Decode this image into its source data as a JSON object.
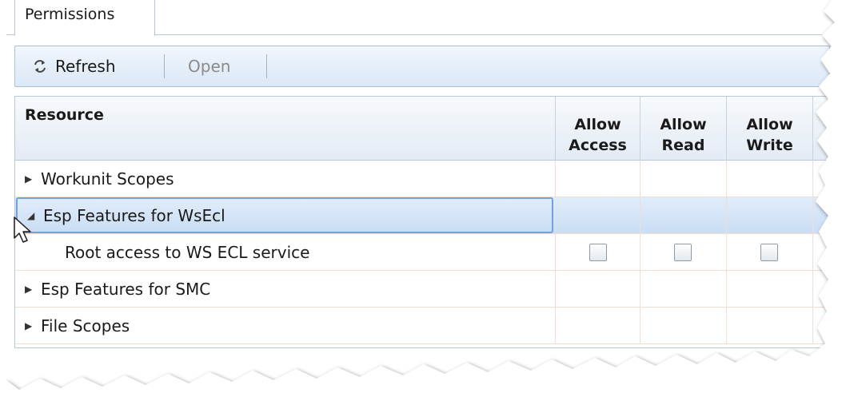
{
  "tab": {
    "label": "Permissions"
  },
  "toolbar": {
    "refresh_label": "Refresh",
    "open_label": "Open"
  },
  "columns": {
    "resource": "Resource",
    "allow_access_1": "Allow",
    "allow_access_2": "Access",
    "allow_read_1": "Allow",
    "allow_read_2": "Read",
    "allow_write_1": "Allow",
    "allow_write_2": "Write"
  },
  "rows": [
    {
      "label": "Workunit Scopes",
      "expanded": false
    },
    {
      "label": "Esp Features for WsEcl",
      "expanded": true,
      "selected": true
    },
    {
      "label": "Root access to WS ECL service",
      "child": true,
      "allow_access": false,
      "allow_read": false,
      "allow_write": false
    },
    {
      "label": "Esp Features for SMC",
      "expanded": false
    },
    {
      "label": "File Scopes",
      "expanded": false
    }
  ],
  "icons": {
    "refresh": "refresh-icon",
    "collapsed": "triangle-right-icon",
    "expanded": "triangle-down-icon"
  }
}
